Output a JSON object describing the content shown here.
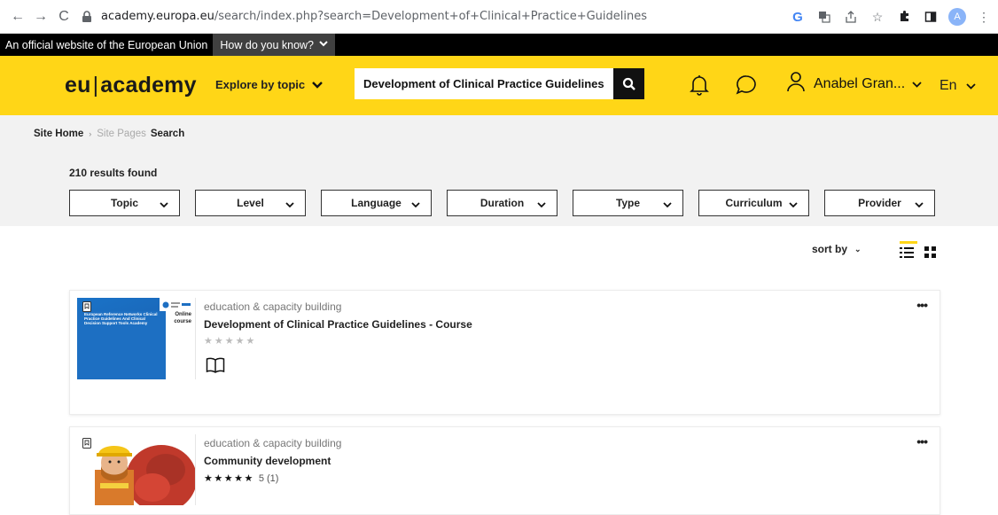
{
  "browser": {
    "url_domain": "academy.europa.eu",
    "url_path": "/search/index.php?search=Development+of+Clinical+Practice+Guidelines",
    "avatar_letter": "A"
  },
  "eu_bar": {
    "official_text": "An official website of the European Union",
    "how_text": "How do you know?"
  },
  "header": {
    "logo_left": "eu",
    "logo_sep": "|",
    "logo_right": "academy",
    "explore_label": "Explore by topic",
    "search_value": "Development of Clinical Practice Guidelines",
    "user_name": "Anabel Gran...",
    "language": "En",
    "brand_color": "#ffd617"
  },
  "breadcrumb": {
    "home": "Site Home",
    "pages": "Site Pages",
    "current": "Search"
  },
  "results_text": "210 results found",
  "filters": [
    "Topic",
    "Level",
    "Language",
    "Duration",
    "Type",
    "Curriculum",
    "Provider"
  ],
  "sort": {
    "label": "sort by"
  },
  "courses": [
    {
      "category": "education & capacity building",
      "title": "Development of Clinical Practice Guidelines - Course",
      "rating_text": "",
      "thumb_text": "European Reference Networks Clinical Practice Guidelines And Clinical Decision Support Tools Academy",
      "thumb_label_1": "Online",
      "thumb_label_2": "course"
    },
    {
      "category": "education & capacity building",
      "title": "Community development",
      "rating_text": "5 (1)"
    }
  ]
}
